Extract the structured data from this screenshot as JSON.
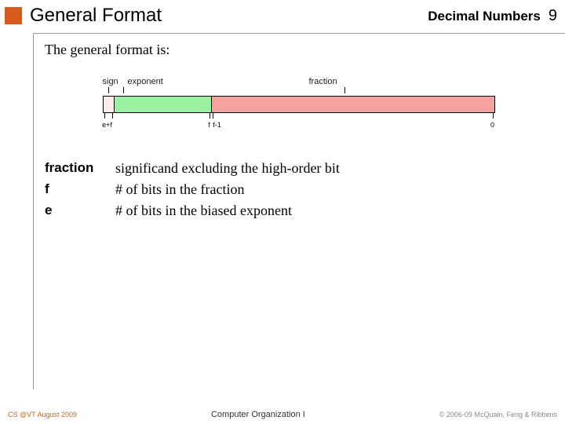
{
  "header": {
    "title": "General Format",
    "topic": "Decimal Numbers",
    "page": "9"
  },
  "intro": "The general format is:",
  "diagram": {
    "labels": {
      "sign": "sign",
      "exponent": "exponent",
      "fraction": "fraction"
    },
    "bottom": {
      "left": "e+f",
      "mid_left": "f",
      "mid_right": "f-1",
      "right": "0"
    }
  },
  "defs": [
    {
      "term": "fraction",
      "defn": "significand excluding the high-order bit"
    },
    {
      "term": "f",
      "defn": "# of bits in the fraction"
    },
    {
      "term": "e",
      "defn": "# of bits in the biased exponent"
    }
  ],
  "footer": {
    "left": "CS @VT August 2009",
    "center": "Computer Organization I",
    "right": "© 2006-09  McQuain, Feng & Ribbens"
  }
}
